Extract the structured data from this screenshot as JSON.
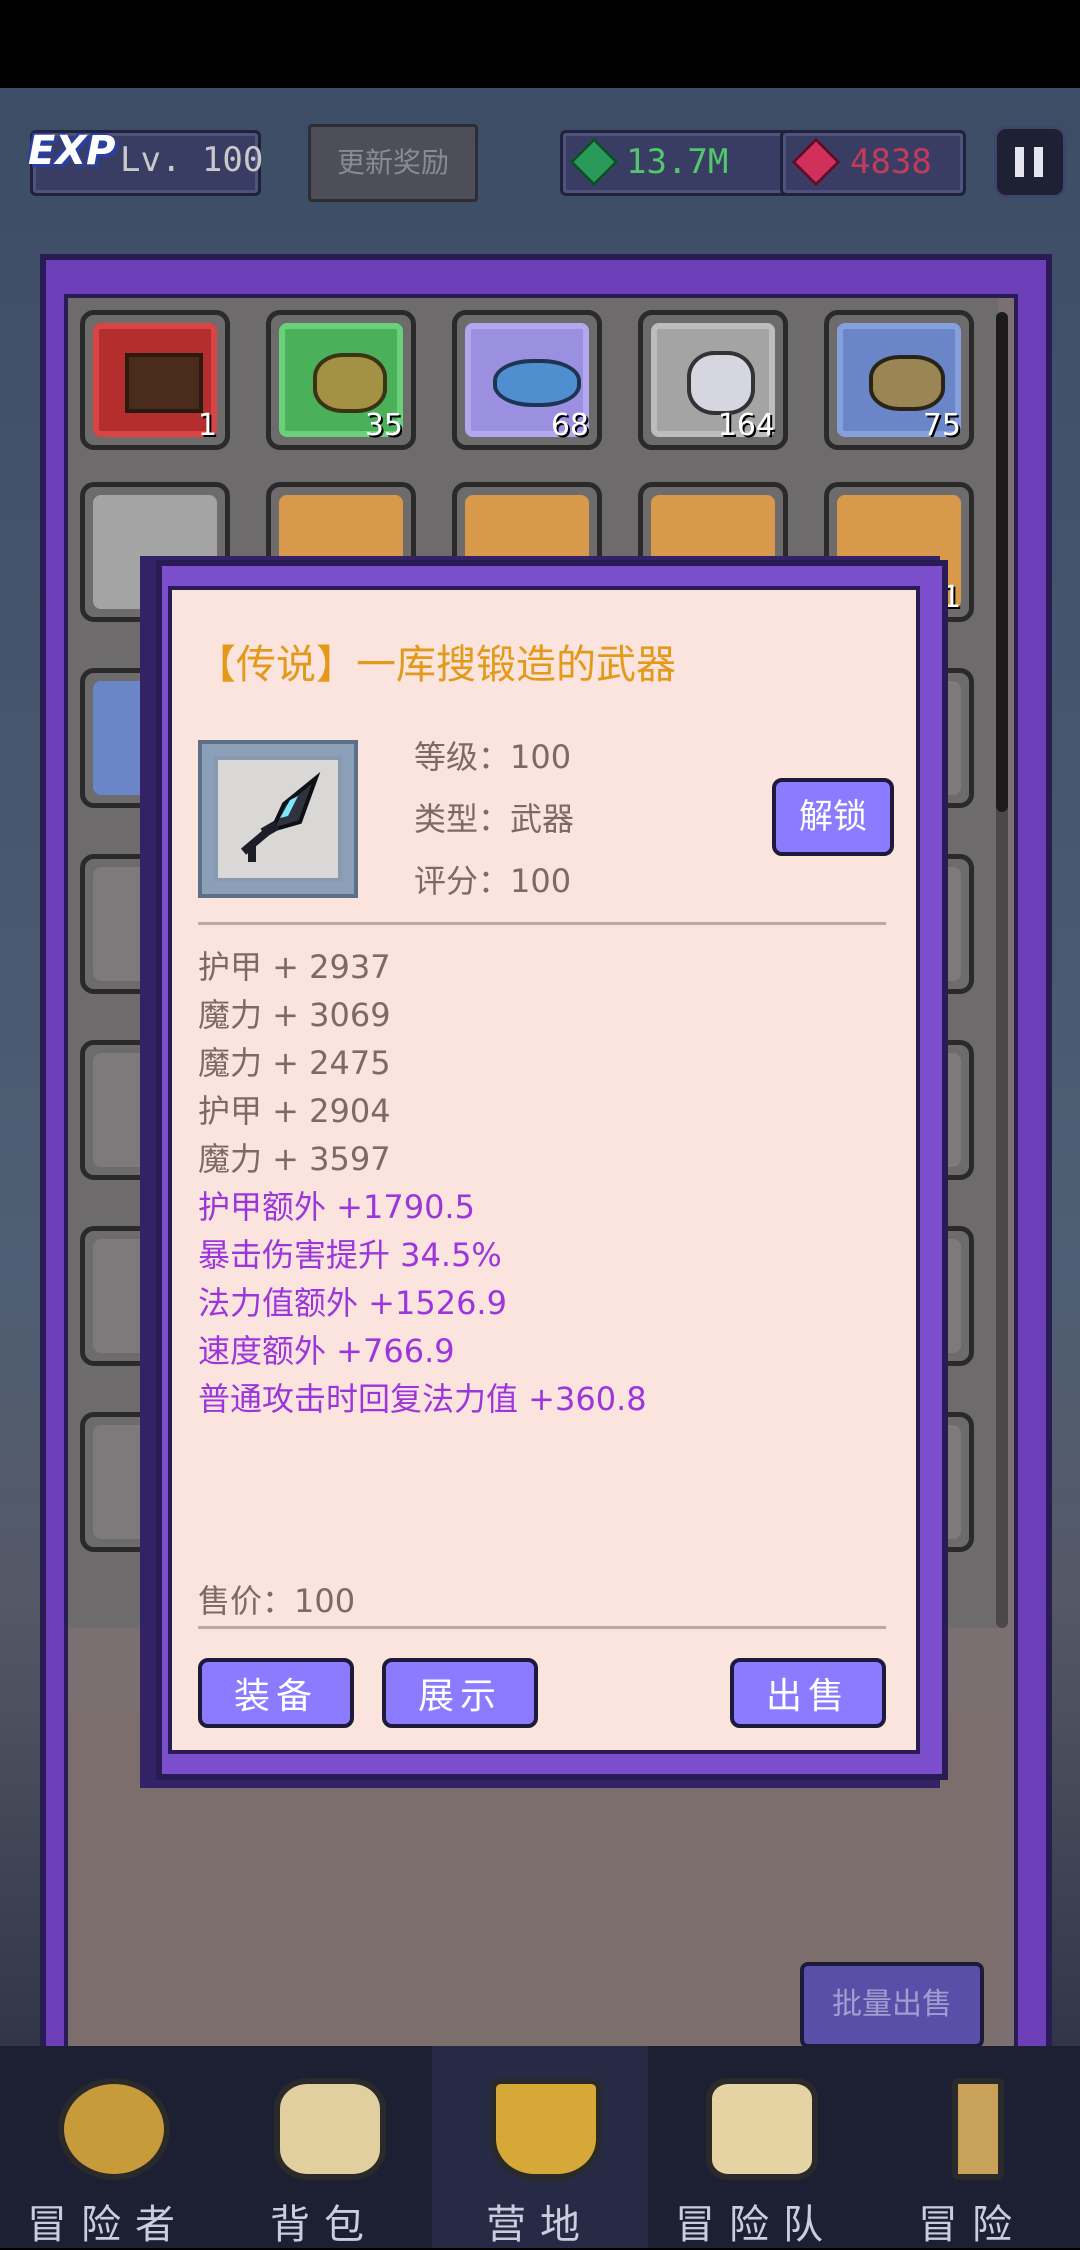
{
  "top_bar": {
    "exp_badge": "EXP",
    "level": "Lv. 100",
    "refresh_label": "更新奖励",
    "green_gems": "13.7M",
    "red_gems": "4838"
  },
  "inventory": {
    "row1_counts": [
      "1",
      "35",
      "68",
      "164",
      "75"
    ],
    "row2_count_last": "1",
    "bulk_sell_label": "批量出售"
  },
  "bottom_nav": {
    "items": [
      {
        "label": "冒险者",
        "icon": "helmet-icon"
      },
      {
        "label": "背包",
        "icon": "backpack-icon"
      },
      {
        "label": "营地",
        "icon": "camp-banner-icon"
      },
      {
        "label": "冒险队",
        "icon": "team-chest-icon"
      },
      {
        "label": "冒险",
        "icon": "sword-icon"
      }
    ]
  },
  "item_modal": {
    "title": "【传说】一库搜锻造的武器",
    "level": "等级：100",
    "type": "类型：武器",
    "score": "评分：100",
    "unlock_label": "解锁",
    "base_stats": [
      "护甲 + 2937",
      "魔力 + 3069",
      "魔力 + 2475",
      "护甲 + 2904",
      "魔力 + 3597"
    ],
    "extra_stats": [
      "护甲额外 +1790.5",
      "暴击伤害提升 34.5%",
      "法力值额外 +1526.9",
      "速度额外 +766.9",
      "普通攻击时回复法力值 +360.8"
    ],
    "price": "售价：100",
    "equip_label": "装备",
    "show_label": "展示",
    "sell_label": "出售",
    "colors": {
      "title": "#e39a1a",
      "extra_stat": "#9b36dc",
      "button": "#8d7bff"
    }
  }
}
